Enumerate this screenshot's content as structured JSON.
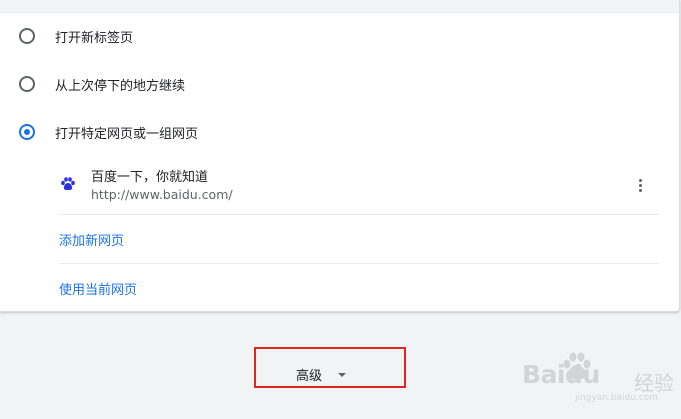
{
  "startup": {
    "options": [
      {
        "label": "打开新标签页",
        "checked": false
      },
      {
        "label": "从上次停下的地方继续",
        "checked": false
      },
      {
        "label": "打开特定网页或一组网页",
        "checked": true
      }
    ],
    "pages": [
      {
        "title": "百度一下，你就知道",
        "url": "http://www.baidu.com/",
        "icon": "baidu-paw-icon"
      }
    ],
    "add_page_label": "添加新网页",
    "use_current_label": "使用当前网页"
  },
  "advanced": {
    "label": "高级",
    "icon": "caret-down-icon"
  },
  "watermark": {
    "brand": "Baidu",
    "sub": "经验",
    "url": "jingyan.baidu.com"
  },
  "colors": {
    "accent": "#1a73e8",
    "highlight_box": "#e0261f",
    "background": "#f1f3f4",
    "card": "#ffffff"
  }
}
